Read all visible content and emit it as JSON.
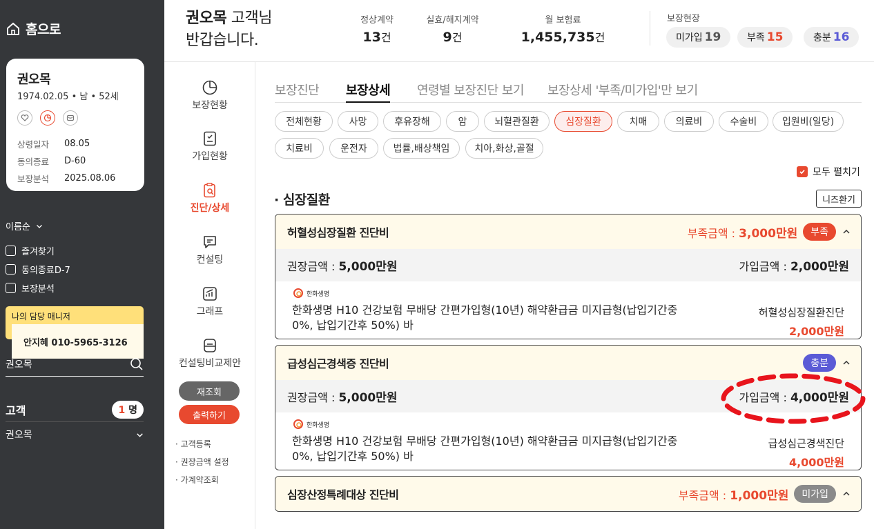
{
  "sidebar": {
    "home_label": "홈으로",
    "customer_card": {
      "name": "권오목",
      "birth_info": "1974.02.05 • 남 • 52세",
      "rows": [
        {
          "key": "상령일자",
          "value": "08.05"
        },
        {
          "key": "동의종료",
          "value": "D-60"
        },
        {
          "key": "보장분석",
          "value": "2025.08.06"
        }
      ]
    },
    "sort_label": "이름순",
    "filters": [
      "즐겨찾기",
      "동의종료D-7",
      "보장분석"
    ],
    "manager": {
      "title": "나의 담당 매니저",
      "contact": "안지혜 010-5965-3126"
    },
    "search_value": "권오목",
    "customer_count": {
      "label": "고객",
      "count": "1",
      "unit": "명"
    },
    "customer_item": "권오목"
  },
  "menu": {
    "items": [
      "보장현황",
      "가입현황",
      "진단/상세",
      "컨설팅",
      "그래프",
      "컨설팅비교제안"
    ],
    "active": "진단/상세",
    "reload_button": "재조회",
    "print_button": "출력하기",
    "links": [
      "· 고객등록",
      "· 권장금액 설정",
      "· 가계약조회"
    ]
  },
  "header": {
    "greeting_name": "권오목",
    "greeting_suffix": " 고객님",
    "greeting_line2": "반갑습니다.",
    "stats": [
      {
        "label": "정상계약",
        "value": "13",
        "unit": "건"
      },
      {
        "label": "실효/해지계약",
        "value": "9",
        "unit": "건"
      },
      {
        "label": "월 보험료",
        "value": "1,455,735",
        "unit": "건"
      }
    ],
    "coverage_label": "보장현장",
    "coverage_chips": [
      {
        "label": "미가입",
        "value": "19",
        "color": "#555555"
      },
      {
        "label": "부족",
        "value": "15",
        "color": "#e8492f"
      },
      {
        "label": "충분",
        "value": "16",
        "color": "#5b5bd6"
      }
    ]
  },
  "tabs": [
    "보장진단",
    "보장상세",
    "연령별 보장진단 보기",
    "보장상세 '부족/미가입'만 보기"
  ],
  "active_tab": "보장상세",
  "categories": [
    "전체현황",
    "사망",
    "후유장해",
    "암",
    "뇌혈관질환",
    "심장질환",
    "치매",
    "의료비",
    "수술비",
    "입원비(일당)",
    "치료비",
    "운전자",
    "법률,배상책임",
    "치아,화상,골절"
  ],
  "active_category": "심장질환",
  "expand_all_label": "모두 펼치기",
  "section_title": "심장질환",
  "needs_button": "니즈환기",
  "panels": [
    {
      "title": "허혈성심장질환 진단비",
      "shortfall_label": "부족금액 : ",
      "shortfall_value": "3,000만원",
      "badge": "부족",
      "badge_color": "#e8492f",
      "recommended_label": "권장금액 : ",
      "recommended_value": "5,000만원",
      "joined_label": "가입금액 : ",
      "joined_value": "2,000만원",
      "insurer": "한화생명",
      "product_name": "한화생명 H10 건강보험 무배당 간편가입형(10년) 해약환급금 미지급형(납입기간중 0%, 납입기간후 50%) 바",
      "coverage_name": "허혈성심장질환진단",
      "coverage_amount": "2,000만원"
    },
    {
      "title": "급성심근경색증 진단비",
      "badge": "충분",
      "badge_color": "#5b5bd6",
      "recommended_label": "권장금액 : ",
      "recommended_value": "5,000만원",
      "joined_label": "가입금액 : ",
      "joined_value": "4,000만원",
      "insurer": "한화생명",
      "product_name": "한화생명 H10 건강보험 무배당 간편가입형(10년) 해약환급금 미지급형(납입기간중 0%, 납입기간후 50%) 바",
      "coverage_name": "급성심근경색진단",
      "coverage_amount": "4,000만원"
    },
    {
      "title": "심장산정특례대상 진단비",
      "shortfall_label": "부족금액 : ",
      "shortfall_value": "1,000만원",
      "badge": "미가입",
      "badge_color": "#8a8a8a"
    }
  ]
}
